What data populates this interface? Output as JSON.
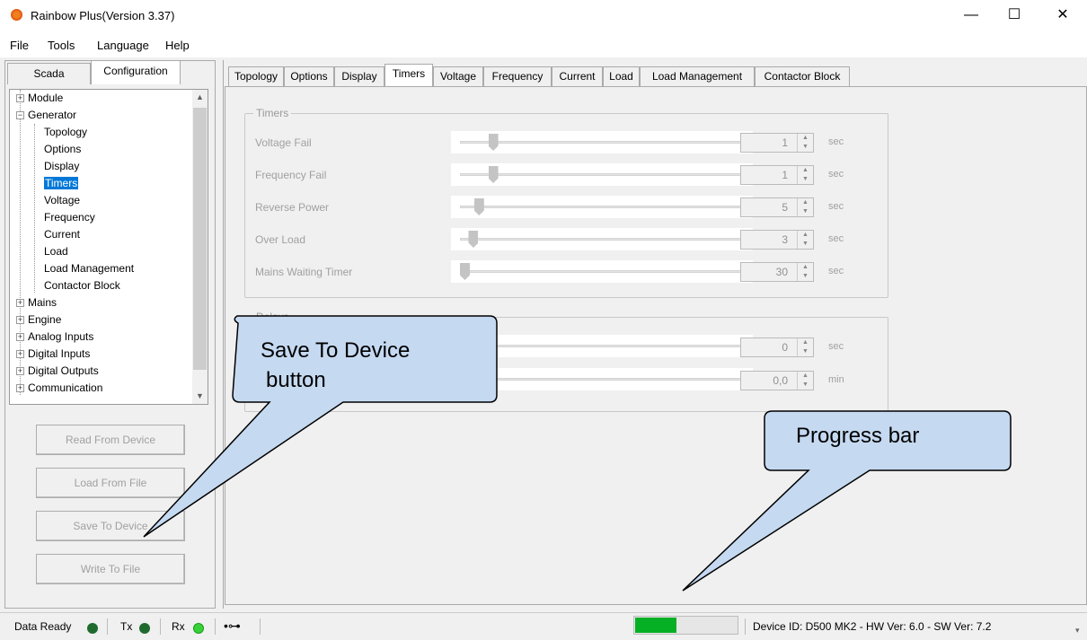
{
  "window": {
    "title": "Rainbow Plus(Version 3.37)",
    "min": "—",
    "max": "☐",
    "close": "✕"
  },
  "menu": [
    "File",
    "Tools",
    "Language",
    "Help"
  ],
  "left_tabs": [
    "Scada",
    "Configuration"
  ],
  "tree": {
    "module": "Module",
    "generator": "Generator",
    "generator_children": [
      "Topology",
      "Options",
      "Display",
      "Timers",
      "Voltage",
      "Frequency",
      "Current",
      "Load",
      "Load Management",
      "Contactor Block"
    ],
    "others": [
      "Mains",
      "Engine",
      "Analog Inputs",
      "Digital Inputs",
      "Digital Outputs",
      "Communication"
    ]
  },
  "side_buttons": {
    "read": "Read From Device",
    "load": "Load From File",
    "save": "Save To Device",
    "write": "Write To File"
  },
  "sub_tabs": [
    "Topology",
    "Options",
    "Display",
    "Timers",
    "Voltage",
    "Frequency",
    "Current",
    "Load",
    "Load Management",
    "Contactor Block"
  ],
  "timers_group": {
    "legend": "Timers",
    "rows": [
      {
        "label": "Voltage Fail",
        "value": "1",
        "unit": "sec",
        "level": 0.1
      },
      {
        "label": "Frequency Fail",
        "value": "1",
        "unit": "sec",
        "level": 0.1
      },
      {
        "label": "Reverse Power",
        "value": "5",
        "unit": "sec",
        "level": 0.05
      },
      {
        "label": "Over Load",
        "value": "3",
        "unit": "sec",
        "level": 0.03
      },
      {
        "label": "Mains Waiting Timer",
        "value": "30",
        "unit": "sec",
        "level": 0.0
      }
    ]
  },
  "delays_group": {
    "legend": "Delays",
    "rows": [
      {
        "value": "0",
        "unit": "sec"
      },
      {
        "value": "0,0",
        "unit": "min"
      }
    ]
  },
  "status": {
    "data_ready": "Data Ready",
    "tx": "Tx",
    "rx": "Rx",
    "usb_icon": "usb-icon",
    "progress_fraction": 0.4,
    "device_info": "Device ID: D500 MK2 - HW Ver: 6.0 - SW Ver: 7.2"
  },
  "callouts": {
    "save": [
      "Save To Device",
      "button"
    ],
    "progress": "Progress bar"
  },
  "colors": {
    "selected": "#0078d7",
    "progress": "#06b025",
    "callout_fill": "#c5d9f1",
    "led_dark": "#1f6b2e",
    "led_rx": "#37d237"
  }
}
